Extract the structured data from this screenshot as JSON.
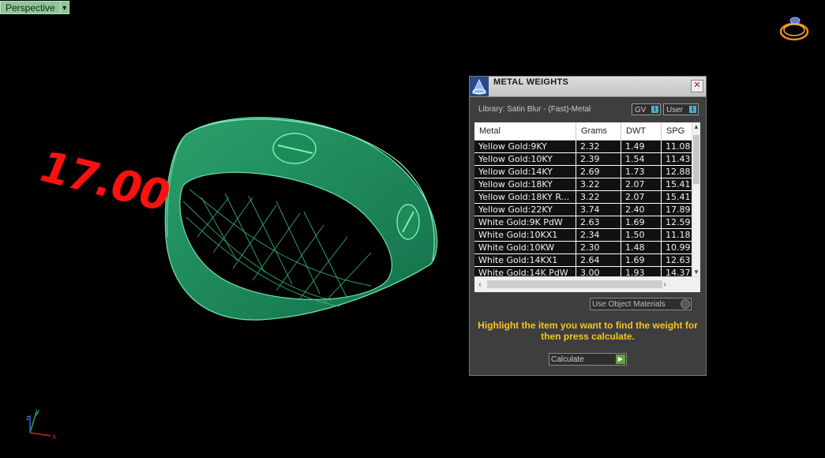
{
  "viewport": {
    "label": "Perspective",
    "ring_size_text": "17.00",
    "axis_labels": {
      "x": "x",
      "y": "y",
      "z": "z"
    }
  },
  "panel": {
    "title": "METAL WEIGHTS",
    "close_symbol": "✕",
    "library_text": "Library: Satin Blur - (Fast)-Metal",
    "toggle_gv": "GV",
    "toggle_user": "User",
    "table": {
      "headers": [
        "Metal",
        "Grams",
        "DWT",
        "SPG"
      ],
      "rows": [
        [
          "Yellow Gold:9KY",
          "2.32",
          "1.49",
          "11.08"
        ],
        [
          "Yellow Gold:10KY",
          "2.39",
          "1.54",
          "11.43"
        ],
        [
          "Yellow Gold:14KY",
          "2.69",
          "1.73",
          "12.88"
        ],
        [
          "Yellow Gold:18KY",
          "3.22",
          "2.07",
          "15.41"
        ],
        [
          "Yellow Gold:18KY R...",
          "3.22",
          "2.07",
          "15.41"
        ],
        [
          "Yellow Gold:22KY",
          "3.74",
          "2.40",
          "17.89"
        ],
        [
          "White Gold:9K PdW",
          "2.63",
          "1.69",
          "12.59"
        ],
        [
          "White Gold:10KX1",
          "2.34",
          "1.50",
          "11.18"
        ],
        [
          "White Gold:10KW",
          "2.30",
          "1.48",
          "10.99"
        ],
        [
          "White Gold:14KX1",
          "2.64",
          "1.69",
          "12.63"
        ],
        [
          "White Gold:14K PdW",
          "3.00",
          "1.93",
          "14.37"
        ]
      ]
    },
    "use_object_materials_label": "Use Object Materials",
    "hint_text": "Highlight the item you want to find the weight for then press calculate.",
    "calculate_label": "Calculate"
  },
  "colors": {
    "ring": "#1f8a5c",
    "ring_size": "#ff1010",
    "hint": "#f7c51d",
    "panel_bg": "#3e3e3e"
  }
}
